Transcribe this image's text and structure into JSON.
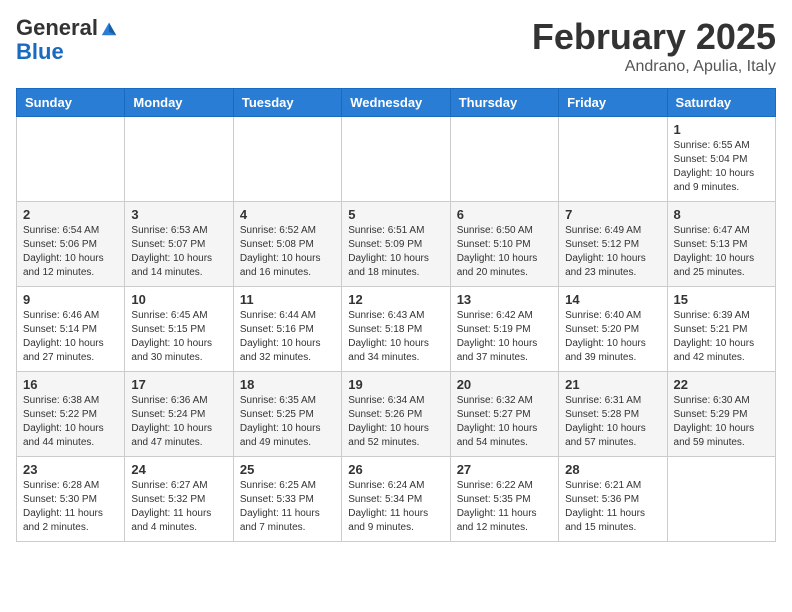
{
  "logo": {
    "general": "General",
    "blue": "Blue"
  },
  "title": "February 2025",
  "location": "Andrano, Apulia, Italy",
  "weekdays": [
    "Sunday",
    "Monday",
    "Tuesday",
    "Wednesday",
    "Thursday",
    "Friday",
    "Saturday"
  ],
  "weeks": [
    [
      {
        "day": "",
        "info": ""
      },
      {
        "day": "",
        "info": ""
      },
      {
        "day": "",
        "info": ""
      },
      {
        "day": "",
        "info": ""
      },
      {
        "day": "",
        "info": ""
      },
      {
        "day": "",
        "info": ""
      },
      {
        "day": "1",
        "info": "Sunrise: 6:55 AM\nSunset: 5:04 PM\nDaylight: 10 hours\nand 9 minutes."
      }
    ],
    [
      {
        "day": "2",
        "info": "Sunrise: 6:54 AM\nSunset: 5:06 PM\nDaylight: 10 hours\nand 12 minutes."
      },
      {
        "day": "3",
        "info": "Sunrise: 6:53 AM\nSunset: 5:07 PM\nDaylight: 10 hours\nand 14 minutes."
      },
      {
        "day": "4",
        "info": "Sunrise: 6:52 AM\nSunset: 5:08 PM\nDaylight: 10 hours\nand 16 minutes."
      },
      {
        "day": "5",
        "info": "Sunrise: 6:51 AM\nSunset: 5:09 PM\nDaylight: 10 hours\nand 18 minutes."
      },
      {
        "day": "6",
        "info": "Sunrise: 6:50 AM\nSunset: 5:10 PM\nDaylight: 10 hours\nand 20 minutes."
      },
      {
        "day": "7",
        "info": "Sunrise: 6:49 AM\nSunset: 5:12 PM\nDaylight: 10 hours\nand 23 minutes."
      },
      {
        "day": "8",
        "info": "Sunrise: 6:47 AM\nSunset: 5:13 PM\nDaylight: 10 hours\nand 25 minutes."
      }
    ],
    [
      {
        "day": "9",
        "info": "Sunrise: 6:46 AM\nSunset: 5:14 PM\nDaylight: 10 hours\nand 27 minutes."
      },
      {
        "day": "10",
        "info": "Sunrise: 6:45 AM\nSunset: 5:15 PM\nDaylight: 10 hours\nand 30 minutes."
      },
      {
        "day": "11",
        "info": "Sunrise: 6:44 AM\nSunset: 5:16 PM\nDaylight: 10 hours\nand 32 minutes."
      },
      {
        "day": "12",
        "info": "Sunrise: 6:43 AM\nSunset: 5:18 PM\nDaylight: 10 hours\nand 34 minutes."
      },
      {
        "day": "13",
        "info": "Sunrise: 6:42 AM\nSunset: 5:19 PM\nDaylight: 10 hours\nand 37 minutes."
      },
      {
        "day": "14",
        "info": "Sunrise: 6:40 AM\nSunset: 5:20 PM\nDaylight: 10 hours\nand 39 minutes."
      },
      {
        "day": "15",
        "info": "Sunrise: 6:39 AM\nSunset: 5:21 PM\nDaylight: 10 hours\nand 42 minutes."
      }
    ],
    [
      {
        "day": "16",
        "info": "Sunrise: 6:38 AM\nSunset: 5:22 PM\nDaylight: 10 hours\nand 44 minutes."
      },
      {
        "day": "17",
        "info": "Sunrise: 6:36 AM\nSunset: 5:24 PM\nDaylight: 10 hours\nand 47 minutes."
      },
      {
        "day": "18",
        "info": "Sunrise: 6:35 AM\nSunset: 5:25 PM\nDaylight: 10 hours\nand 49 minutes."
      },
      {
        "day": "19",
        "info": "Sunrise: 6:34 AM\nSunset: 5:26 PM\nDaylight: 10 hours\nand 52 minutes."
      },
      {
        "day": "20",
        "info": "Sunrise: 6:32 AM\nSunset: 5:27 PM\nDaylight: 10 hours\nand 54 minutes."
      },
      {
        "day": "21",
        "info": "Sunrise: 6:31 AM\nSunset: 5:28 PM\nDaylight: 10 hours\nand 57 minutes."
      },
      {
        "day": "22",
        "info": "Sunrise: 6:30 AM\nSunset: 5:29 PM\nDaylight: 10 hours\nand 59 minutes."
      }
    ],
    [
      {
        "day": "23",
        "info": "Sunrise: 6:28 AM\nSunset: 5:30 PM\nDaylight: 11 hours\nand 2 minutes."
      },
      {
        "day": "24",
        "info": "Sunrise: 6:27 AM\nSunset: 5:32 PM\nDaylight: 11 hours\nand 4 minutes."
      },
      {
        "day": "25",
        "info": "Sunrise: 6:25 AM\nSunset: 5:33 PM\nDaylight: 11 hours\nand 7 minutes."
      },
      {
        "day": "26",
        "info": "Sunrise: 6:24 AM\nSunset: 5:34 PM\nDaylight: 11 hours\nand 9 minutes."
      },
      {
        "day": "27",
        "info": "Sunrise: 6:22 AM\nSunset: 5:35 PM\nDaylight: 11 hours\nand 12 minutes."
      },
      {
        "day": "28",
        "info": "Sunrise: 6:21 AM\nSunset: 5:36 PM\nDaylight: 11 hours\nand 15 minutes."
      },
      {
        "day": "",
        "info": ""
      }
    ]
  ]
}
